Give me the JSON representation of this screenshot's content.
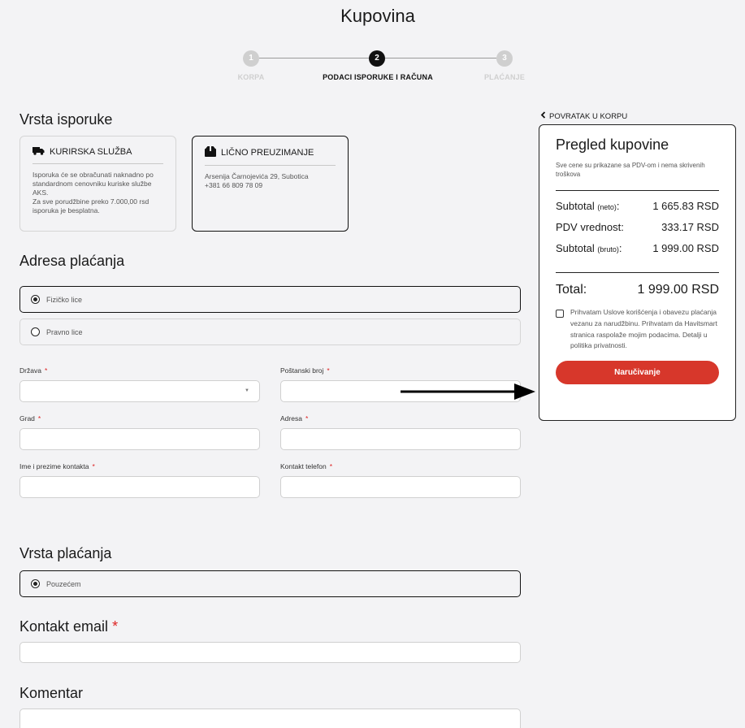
{
  "page": {
    "title": "Kupovina"
  },
  "steps": [
    {
      "number": "1",
      "label": "KORPA",
      "state": "done"
    },
    {
      "number": "2",
      "label": "PODACI ISPORUKE I RAČUNA",
      "state": "active"
    },
    {
      "number": "3",
      "label": "PLAĆANJE",
      "state": "pending"
    }
  ],
  "shipping": {
    "title": "Vrsta isporuke",
    "options": [
      {
        "icon": "truck-icon",
        "label": "KURIRSKA SLUŽBA",
        "description": "Isporuka će se obračunati naknadno po standardnom cenovniku kuriske službe AKS.\nZa sve porudžbine preko 7.000,00 rsd isporuka je besplatna.",
        "selected": false
      },
      {
        "icon": "box-icon",
        "label": "LIČNO PREUZIMANJE",
        "description": "Arsenija Čarnojevića 29, Subotica\n+381 66 809 78 09",
        "selected": true
      }
    ]
  },
  "billing": {
    "title": "Adresa plaćanja",
    "types": [
      {
        "label": "Fizičko lice",
        "selected": true
      },
      {
        "label": "Pravno lice",
        "selected": false
      }
    ],
    "fields": {
      "country": {
        "label": "Država",
        "value": ""
      },
      "postal": {
        "label": "Poštanski broj",
        "value": ""
      },
      "city": {
        "label": "Grad",
        "value": ""
      },
      "address": {
        "label": "Adresa",
        "value": ""
      },
      "contact_name": {
        "label": "Ime i prezime kontakta",
        "value": ""
      },
      "phone": {
        "label": "Kontakt telefon",
        "value": ""
      }
    },
    "required_mark": "*"
  },
  "payment": {
    "title": "Vrsta plaćanja",
    "options": [
      {
        "label": "Pouzećem",
        "selected": true
      }
    ]
  },
  "email": {
    "title": "Kontakt email",
    "required_mark": "*",
    "value": ""
  },
  "comment": {
    "title": "Komentar",
    "value": ""
  },
  "summary": {
    "back_label": "POVRATAK U KORPU",
    "title": "Pregled kupovine",
    "note": "Sve cene su prikazane sa PDV-om i nema skrivenih troškova",
    "rows": [
      {
        "label": "Subtotal",
        "sub": "(neto)",
        "suffix": ":",
        "value": "1 665.83 RSD"
      },
      {
        "label": "PDV vrednost:",
        "sub": "",
        "suffix": "",
        "value": "333.17 RSD"
      },
      {
        "label": "Subtotal",
        "sub": "(bruto)",
        "suffix": ":",
        "value": "1 999.00 RSD"
      }
    ],
    "total_label": "Total:",
    "total_value": "1 999.00 RSD",
    "consent": "Prihvatam Uslove korišćenja i obavezu plaćanja vezanu za narudžbinu. Prihvatam da Havitsmart stranica raspolaže mojim podacima. Detalji u politika privatnosti.",
    "consent_checked": false,
    "order_button": "Naručivanje"
  },
  "colors": {
    "accent": "#d7372b",
    "background": "#f3f3f5",
    "active_step": "#111111",
    "inactive_step": "#cfcfcf"
  }
}
